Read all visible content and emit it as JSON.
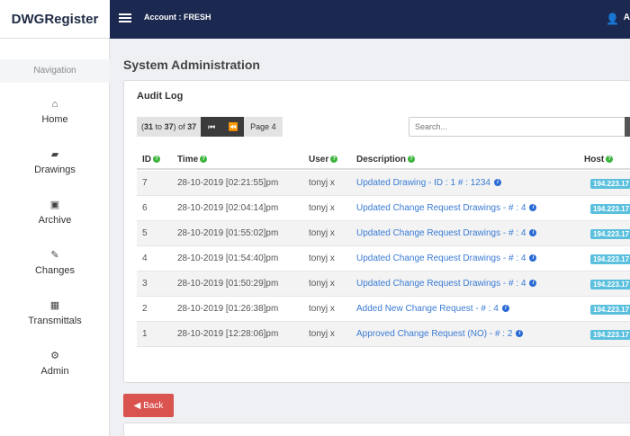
{
  "brand": "DWGRegister",
  "topbar": {
    "account": "Account : FRESH",
    "user_icon": "user-icon",
    "user_initial": "A"
  },
  "sidebar": {
    "title": "Navigation",
    "items": [
      {
        "label": "Home",
        "icon": "home-icon",
        "glyph": "⌂"
      },
      {
        "label": "Drawings",
        "icon": "folder-icon",
        "glyph": "▰"
      },
      {
        "label": "Archive",
        "icon": "archive-icon",
        "glyph": "▣"
      },
      {
        "label": "Changes",
        "icon": "edit-icon",
        "glyph": "✎"
      },
      {
        "label": "Transmittals",
        "icon": "share-icon",
        "glyph": "▦"
      },
      {
        "label": "Admin",
        "icon": "cogs-icon",
        "glyph": "⚙"
      }
    ]
  },
  "page_title": "System Administration",
  "audit": {
    "title": "Audit Log",
    "pager": {
      "range_start": "31",
      "range_end": "37",
      "to_word": "to",
      "of_word": "of",
      "total": "37",
      "page_label": "Page 4",
      "first_glyph": "⏮",
      "prev_glyph": "⏪"
    },
    "search_placeholder": "Search...",
    "columns": [
      "ID",
      "Time",
      "User",
      "Description",
      "Host"
    ],
    "rows": [
      {
        "id": "7",
        "time": "28-10-2019 [02:21:55]pm",
        "user": "tonyj x",
        "desc": "Updated Drawing - ID : 1 # : 1234",
        "host": "194.223.17"
      },
      {
        "id": "6",
        "time": "28-10-2019 [02:04:14]pm",
        "user": "tonyj x",
        "desc": "Updated Change Request Drawings - # : 4",
        "host": "194.223.17"
      },
      {
        "id": "5",
        "time": "28-10-2019 [01:55:02]pm",
        "user": "tonyj x",
        "desc": "Updated Change Request Drawings - # : 4",
        "host": "194.223.17"
      },
      {
        "id": "4",
        "time": "28-10-2019 [01:54:40]pm",
        "user": "tonyj x",
        "desc": "Updated Change Request Drawings - # : 4",
        "host": "194.223.17"
      },
      {
        "id": "3",
        "time": "28-10-2019 [01:50:29]pm",
        "user": "tonyj x",
        "desc": "Updated Change Request Drawings - # : 4",
        "host": "194.223.17"
      },
      {
        "id": "2",
        "time": "28-10-2019 [01:26:38]pm",
        "user": "tonyj x",
        "desc": "Added New Change Request - # : 4",
        "host": "194.223.17"
      },
      {
        "id": "1",
        "time": "28-10-2019 [12:28:06]pm",
        "user": "tonyj x",
        "desc": "Approved Change Request (NO) - # : 2",
        "host": "194.223.17"
      }
    ]
  },
  "back_button": {
    "icon": "back-circle-icon",
    "glyph": "◀",
    "label": "Back"
  }
}
